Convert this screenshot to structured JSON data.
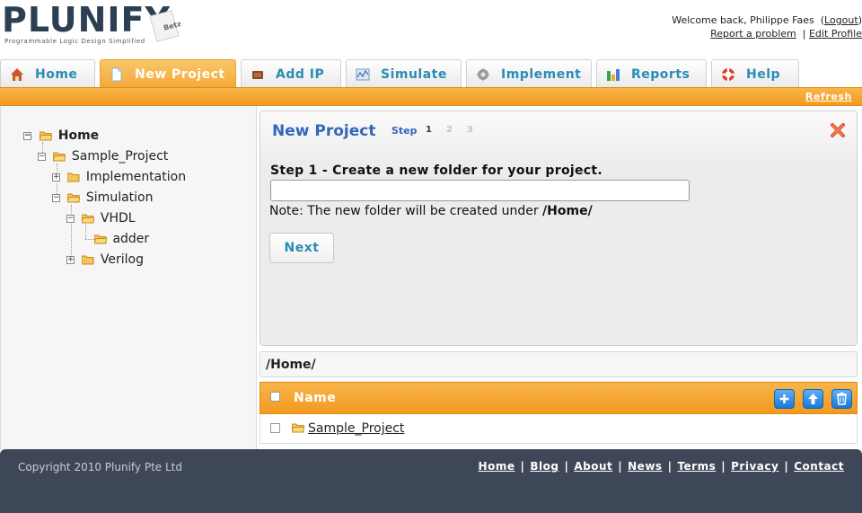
{
  "header": {
    "logo_text": "PLUNIFY",
    "logo_tagline": "Programmable Logic Design Simplified",
    "logo_badge": "Beta",
    "welcome": "Welcome back, Philippe Faes",
    "logout": "Logout",
    "report_problem": "Report a problem",
    "edit_profile": "Edit Profile"
  },
  "tabs": [
    {
      "label": "Home",
      "icon": "house-icon",
      "active": false
    },
    {
      "label": "New Project",
      "icon": "page-icon",
      "active": true
    },
    {
      "label": "Add IP",
      "icon": "chip-icon",
      "active": false
    },
    {
      "label": "Simulate",
      "icon": "waveform-icon",
      "active": false
    },
    {
      "label": "Implement",
      "icon": "gear-icon",
      "active": false
    },
    {
      "label": "Reports",
      "icon": "bar-chart-icon",
      "active": false
    },
    {
      "label": "Help",
      "icon": "lifebuoy-icon",
      "active": false
    }
  ],
  "toolbar": {
    "refresh": "Refresh"
  },
  "tree": {
    "root": "Home",
    "sample_project": "Sample_Project",
    "implementation": "Implementation",
    "simulation": "Simulation",
    "vhdl": "VHDL",
    "adder": "adder",
    "verilog": "Verilog"
  },
  "wizard": {
    "title": "New Project",
    "step_label": "Step",
    "steps": [
      "1",
      "2",
      "3"
    ],
    "current_step": 1,
    "heading": "Step 1 - Create a new folder for your project.",
    "input_value": "",
    "input_placeholder": "",
    "note_prefix": "Note: The new folder will be created under ",
    "note_path": "/Home/",
    "next": "Next"
  },
  "browser": {
    "path": "/Home/",
    "column_name": "Name",
    "rows": [
      {
        "name": "Sample_Project"
      }
    ]
  },
  "footer": {
    "copyright": "Copyright 2010 Plunify Pte Ltd",
    "links": [
      "Home",
      "Blog",
      "About",
      "News",
      "Terms",
      "Privacy",
      "Contact"
    ]
  },
  "colors": {
    "accent_orange": "#f5a939",
    "link_blue": "#2a8bb5",
    "title_blue": "#3467b8",
    "footer_bg": "#3e4758"
  }
}
